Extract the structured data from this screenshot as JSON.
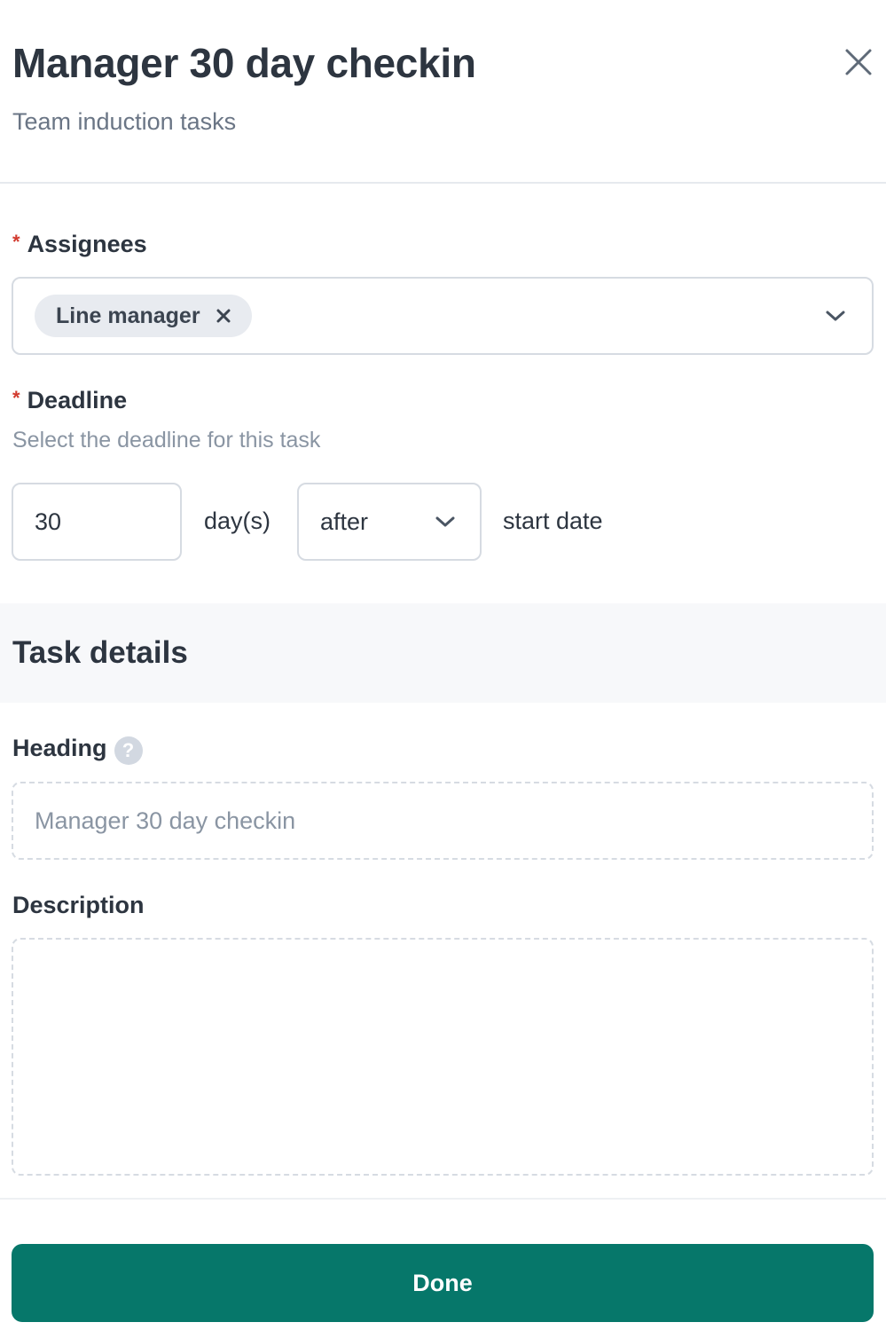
{
  "header": {
    "title": "Manager 30 day checkin",
    "subtitle": "Team induction tasks",
    "close_icon": "close-icon"
  },
  "assignees": {
    "label": "Assignees",
    "required_marker": "*",
    "chips": [
      {
        "label": "Line manager",
        "remove_icon": "x-icon"
      }
    ],
    "dropdown_icon": "chevron-down-icon"
  },
  "deadline": {
    "label": "Deadline",
    "required_marker": "*",
    "hint": "Select the deadline for this task",
    "amount": "30",
    "unit_text": "day(s)",
    "relation": "after",
    "relation_dropdown_icon": "chevron-down-icon",
    "reference_text": "start date"
  },
  "task_details": {
    "section_title": "Task details",
    "heading": {
      "label": "Heading",
      "help_icon": "question-icon",
      "help_glyph": "?",
      "placeholder": "Manager 30 day checkin"
    },
    "description": {
      "label": "Description",
      "value": ""
    }
  },
  "footer": {
    "done_label": "Done"
  },
  "colors": {
    "primary": "#06776a",
    "required": "#d23a2e",
    "text": "#2d3540",
    "muted": "#8a95a3",
    "border": "#d6dbe2"
  }
}
